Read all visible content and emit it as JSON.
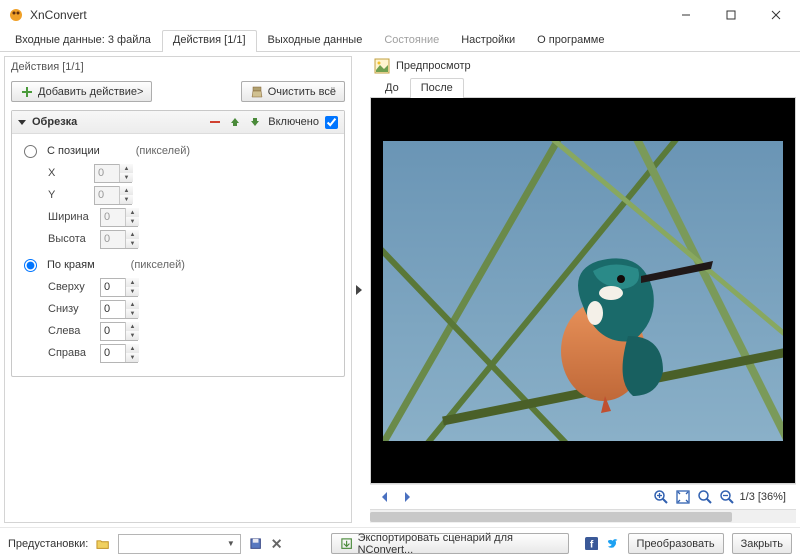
{
  "window": {
    "title": "XnConvert"
  },
  "main_tabs": {
    "input": "Входные данные: 3 файла",
    "actions": "Действия [1/1]",
    "output": "Выходные данные",
    "status": "Состояние",
    "settings": "Настройки",
    "about": "О программе"
  },
  "actions": {
    "header": "Действия [1/1]",
    "add": "Добавить действие>",
    "clear": "Очистить всё"
  },
  "crop": {
    "title": "Обрезка",
    "enabled_label": "Включено",
    "from_position": "С позиции",
    "by_edges": "По краям",
    "unit": "(пикселей)",
    "x": "X",
    "x_val": "0",
    "y": "Y",
    "y_val": "0",
    "width": "Ширина",
    "width_val": "0",
    "height": "Высота",
    "height_val": "0",
    "top": "Сверху",
    "top_val": "0",
    "bottom": "Снизу",
    "bottom_val": "0",
    "left": "Слева",
    "left_val": "0",
    "right": "Справа",
    "right_val": "0"
  },
  "preview": {
    "title": "Предпросмотр",
    "before": "До",
    "after": "После",
    "status": "1/3 [36%]"
  },
  "footer": {
    "presets": "Предустановки:",
    "export": "Экспортировать сценарий для NConvert...",
    "convert": "Преобразовать",
    "close": "Закрыть"
  }
}
